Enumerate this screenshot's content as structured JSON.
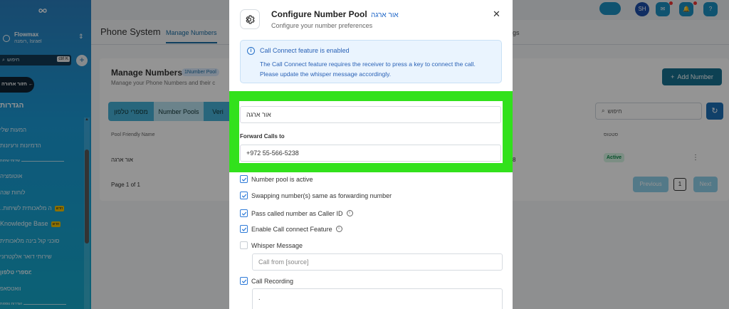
{
  "sidebar": {
    "user_name": "Flowmax",
    "user_sub": "רומנה, Israel",
    "search_placeholder": "חיפוש",
    "search_shortcut": "ctrl K",
    "plus": "+",
    "back_label": "חזור אחורה ←",
    "heading": "הגדרות",
    "items": [
      {
        "label": "המעות שלי"
      },
      {
        "label": "הדמיונות ורעיונות"
      },
      {
        "label": "אוטומציה"
      },
      {
        "label": "לוחות שנה"
      },
      {
        "label": "..ה מלאכותית לשיחות"
      },
      {
        "label": "Knowledge Base"
      },
      {
        "label": "סוכני קול בינה מלאכותית"
      },
      {
        "label": "שירותי דואר אלקטרוני"
      },
      {
        "label": "מספרי טלפון"
      },
      {
        "label": "וואטסאפ"
      }
    ],
    "divider_1": "שירותי שיחות",
    "divider_2": "הגדרות נוספות",
    "badge_new": "חדש"
  },
  "header": {
    "page_title": "Phone System",
    "tab_manage": "Manage Numbers",
    "tab_settings": "ttings",
    "avatar_initials": "SH",
    "help": "?"
  },
  "manage": {
    "title": "Manage Numbers",
    "badge": "1Number Pool",
    "subtitle": "Manage your Phone Numbers and their c",
    "add_button": "Add Number",
    "segments": [
      "מספרי טלפון",
      "Number Pools",
      "Veri"
    ],
    "search_placeholder": "חיפוש",
    "col_name": "Pool Friendly Name",
    "col_status": "סטטוס",
    "row_name": "אור ארגה",
    "row_extra": "8",
    "row_status": "Active",
    "pager_label": "Page 1 of 1",
    "prev": "Previous",
    "page": "1",
    "next": "Next"
  },
  "modal": {
    "title": "Configure Number Pool",
    "title_name": "אור ארגה",
    "subtitle": "Configure your number preferences",
    "info_title": "Call Connect feature is enabled",
    "info_text": "The Call Connect feature requires the receiver to press a key to connect the call. Please update the whisper message accordingly.",
    "name_value": "אור ארגה",
    "forward_label": "Forward Calls to",
    "forward_value": "+972 55-566-5238",
    "checks": [
      {
        "label": "Number pool is active",
        "checked": true
      },
      {
        "label": "Swapping number(s) same as forwarding number",
        "checked": true
      },
      {
        "label": "Pass called number as Caller ID",
        "checked": true
      },
      {
        "label": "Enable Call connect Feature",
        "checked": true
      },
      {
        "label": "Whisper Message",
        "checked": false
      }
    ],
    "whisper_placeholder": "Call from [source]",
    "recording_label": "Call Recording",
    "recording_value": "."
  },
  "colors": {
    "accent": "#1c6fb6",
    "highlight": "#32e11c",
    "info_bg": "#eaf4fe"
  }
}
